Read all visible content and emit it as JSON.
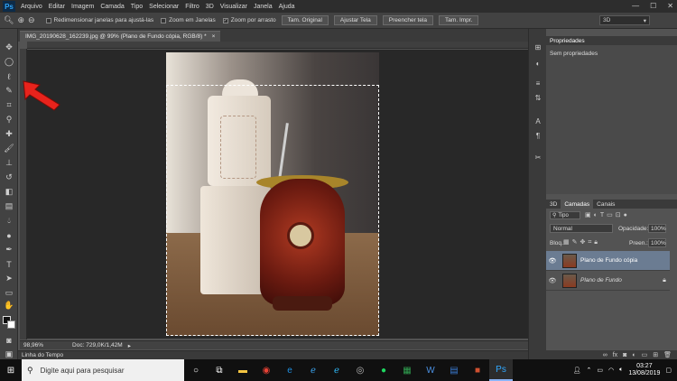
{
  "menubar": {
    "logo": "Ps",
    "items": [
      "Arquivo",
      "Editar",
      "Imagem",
      "Camada",
      "Tipo",
      "Selecionar",
      "Filtro",
      "3D",
      "Visualizar",
      "Janela",
      "Ajuda"
    ],
    "win_min": "—",
    "win_max": "☐",
    "win_close": "✕"
  },
  "options": {
    "resize_windows": "Redimensionar janelas para ajustá-las",
    "zoom_all": "Zoom em Janelas",
    "scrubby_zoom": "Zoom por arrasto",
    "btn_actual": "Tam. Original",
    "btn_fit": "Ajustar Tela",
    "btn_fill": "Preencher tela",
    "btn_print": "Tam. Impr.",
    "workspace": "3D"
  },
  "document": {
    "tab_title": "IMG_20190628_162239.jpg @ 99% (Plano de Fundo cópia, RGB/8) *",
    "tab_close": "×"
  },
  "status": {
    "zoom": "98,96%",
    "doc": "Doc: 729,0K/1,42M"
  },
  "timeline": {
    "label": "Linha do Tempo"
  },
  "properties": {
    "title": "Propriedades",
    "empty": "Sem propriedades"
  },
  "layers": {
    "tabs": [
      "3D",
      "Camadas",
      "Canais"
    ],
    "active_tab": 1,
    "kind": "Tipo",
    "blend": "Normal",
    "opacity_label": "Opacidade:",
    "opacity": "100%",
    "lock_label": "Bloq.:",
    "fill_label": "Preen.:",
    "fill": "100%",
    "rows": [
      {
        "name": "Plano de Fundo cópia",
        "selected": true,
        "locked": false
      },
      {
        "name": "Plano de Fundo",
        "selected": false,
        "locked": true
      }
    ]
  },
  "taskbar": {
    "search_placeholder": "Digite aqui para pesquisar",
    "time": "03:27",
    "date": "13/08/2019"
  },
  "colors": {
    "accent_selected_layer": "#6b7c92",
    "annotation_arrow": "#e8231c"
  }
}
